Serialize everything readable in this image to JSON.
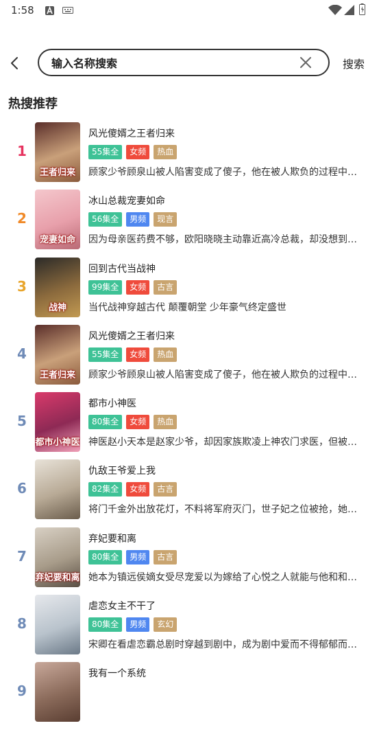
{
  "status_bar": {
    "time": "1:58"
  },
  "search": {
    "placeholder": "输入名称搜索",
    "value": "",
    "button_label": "搜索"
  },
  "section_title": "热搜推荐",
  "colors": {
    "episodes": "#3ec296",
    "female": "#ef4b3c",
    "male": "#4f87f0",
    "genre": "#c9a46f",
    "rank_1": "#e6335f",
    "rank_2": "#f08a29",
    "rank_3": "#e8a52c",
    "rank_other": "#6f8bb7"
  },
  "items": [
    {
      "rank": "1",
      "title": "风光傻婿之王者归来",
      "episodes": "55集全",
      "channel": "女频",
      "genre": "热血",
      "desc": "顾家少爷顾泉山被人陷害变成了傻子，他在被人欺负的过程中意外觉醒",
      "cover_text": "王者归来"
    },
    {
      "rank": "2",
      "title": "冰山总裁宠妻如命",
      "episodes": "56集全",
      "channel": "男频",
      "genre": "现言",
      "desc": "因为母亲医药费不够，欧阳晓晓主动靠近高冷总裁，却没想到被他宠上天",
      "cover_text": "宠妻如命"
    },
    {
      "rank": "3",
      "title": "回到古代当战神",
      "episodes": "99集全",
      "channel": "女频",
      "genre": "古言",
      "desc": "当代战神穿越古代 颠覆朝堂 少年豪气终定盛世",
      "cover_text": "战神"
    },
    {
      "rank": "4",
      "title": "风光傻婿之王者归来",
      "episodes": "55集全",
      "channel": "女频",
      "genre": "热血",
      "desc": "顾家少爷顾泉山被人陷害变成了傻子，他在被人欺负的过程中意外觉醒",
      "cover_text": "王者归来"
    },
    {
      "rank": "5",
      "title": "都市小神医",
      "episodes": "80集全",
      "channel": "女频",
      "genre": "热血",
      "desc": "神医赵小天本是赵家少爷，却因家族欺凌上神农门求医，但被拒之门外",
      "cover_text": "都市小神医"
    },
    {
      "rank": "6",
      "title": "仇敌王爷爱上我",
      "episodes": "82集全",
      "channel": "女频",
      "genre": "古言",
      "desc": "将门千金外出放花灯，不料将军府灭门，世子妃之位被抢，她决心复仇",
      "cover_text": ""
    },
    {
      "rank": "7",
      "title": "弃妃要和离",
      "episodes": "80集全",
      "channel": "男频",
      "genre": "古言",
      "desc": "她本为镇远侯嫡女受尽宠爱以为嫁给了心悦之人就能与他和和美美一生",
      "cover_text": "弃妃要和离"
    },
    {
      "rank": "8",
      "title": "虐恋女主不干了",
      "episodes": "80集全",
      "channel": "男频",
      "genre": "玄幻",
      "desc": "宋卿在看虐恋霸总剧时穿越到剧中，成为剧中爱而不得郁郁而终的女主",
      "cover_text": ""
    },
    {
      "rank": "9",
      "title": "我有一个系统",
      "episodes": "",
      "channel": "",
      "genre": "",
      "desc": "",
      "cover_text": ""
    }
  ]
}
